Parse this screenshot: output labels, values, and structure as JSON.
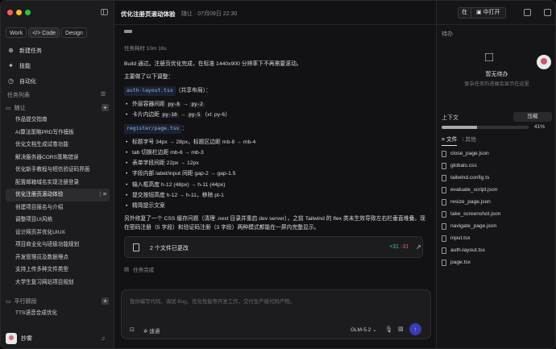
{
  "sidebar": {
    "modes": [
      "Work",
      "Code",
      "Design"
    ],
    "nav": [
      {
        "label": "新建任务",
        "icon": "plus-circle-icon"
      },
      {
        "label": "技能",
        "icon": "puzzle-icon"
      },
      {
        "label": "自动化",
        "icon": "clock-icon"
      }
    ],
    "task_list_title": "任务列表",
    "group1": "随让",
    "tasks": [
      "作品提交指南",
      "AI算法策略PRD写作模板",
      "优化文档生成试卷功能",
      "解决服务器CORS策略错误",
      "优化新手教程与短信验证码界面",
      "配置邮箱域名实现注册登录",
      "优化注册页滚动体验",
      "创建项目报名与介绍",
      "调整项目UI风格",
      "设计网页并优化UIUX",
      "项目商业化与班级功能规划",
      "开发管理员及数据埋点",
      "支持上传多种文件类型",
      "大学生复习网站项目规划"
    ],
    "active_task_index": 6,
    "group2": "平行顾段",
    "tasks2": [
      "TTS语音合成优化"
    ],
    "user": "抄雾"
  },
  "header": {
    "title": "优化注册页滚动体验",
    "meta": "随让 · 07月09日 22:30",
    "open_prefix": "在",
    "open_button": "中打开"
  },
  "chat": {
    "elapsed": "任务耗时 10m 16s",
    "intro": "Build 通过。注册页优化完成，在标准 1440x900 分辨率下不再需要滚动。",
    "changes_intro": "主要做了以下调整：",
    "section1": "auth-layout.tsx",
    "section1_note": "（共享布局）：",
    "section1_items": [
      {
        "text": "外层容器间距 ",
        "codes": [
          "py-8",
          "py-2"
        ],
        "sep": " → "
      },
      {
        "text": "卡片内边距 ",
        "codes": [
          "py-10",
          "py-5"
        ],
        "sep": " → ",
        "suffix": "（xl: py-6）"
      }
    ],
    "section2": "register/page.tsx",
    "section2_items": [
      "标题字号 34px → 28px，标题区边距 mb-8 → mb-4",
      "tab 切换栏边距 mb-6 → mb-3",
      "表单字段间距 22px → 12px",
      "字段内部 label/input 间距 gap-2 → gap-1.5",
      "输入框高度 h-12 (48px) → h-11 (44px)",
      "提交按钮高度 h-12 → h-11，移除 pt-1",
      "精简提示文案"
    ],
    "outro": "另外修复了一个 CSS 缓存问题（清理 .next 目录并重启 dev server），之前 Tailwind 的 flex 类未生效导致左右栏垂直堆叠。现在密码注册（5 字段）和验证码注册（3 字段）两种模式都能在一屏内完整显示。",
    "changes_label": "2 个文件已更改",
    "additions": "+31",
    "deletions": "-31",
    "done": "任务完成"
  },
  "composer": {
    "placeholder": "我你编写代码、调试 Bug、优化性能等开发工作，交付生产级代码产物。",
    "speed": "速通",
    "model": "GLM-5.2"
  },
  "right": {
    "todo_title": "待办",
    "empty_title": "暂无待办",
    "empty_sub": "复杂任务的进展会显示在这里",
    "context_label": "上下文",
    "compress": "压缩",
    "context_pct": 41,
    "context_pct_label": "41%",
    "tabs": [
      "文件",
      "其他"
    ],
    "files": [
      "close_page.json",
      "globals.css",
      "tailwind.config.ts",
      "evaluate_script.json",
      "resize_page.json",
      "take_screenshot.json",
      "navigate_page.json",
      "input.tsx",
      "auth-layout.tsx",
      "page.tsx"
    ]
  },
  "colors": {
    "accent": "#3b3bb8",
    "add": "#4cc38a",
    "del": "#e5606a"
  }
}
